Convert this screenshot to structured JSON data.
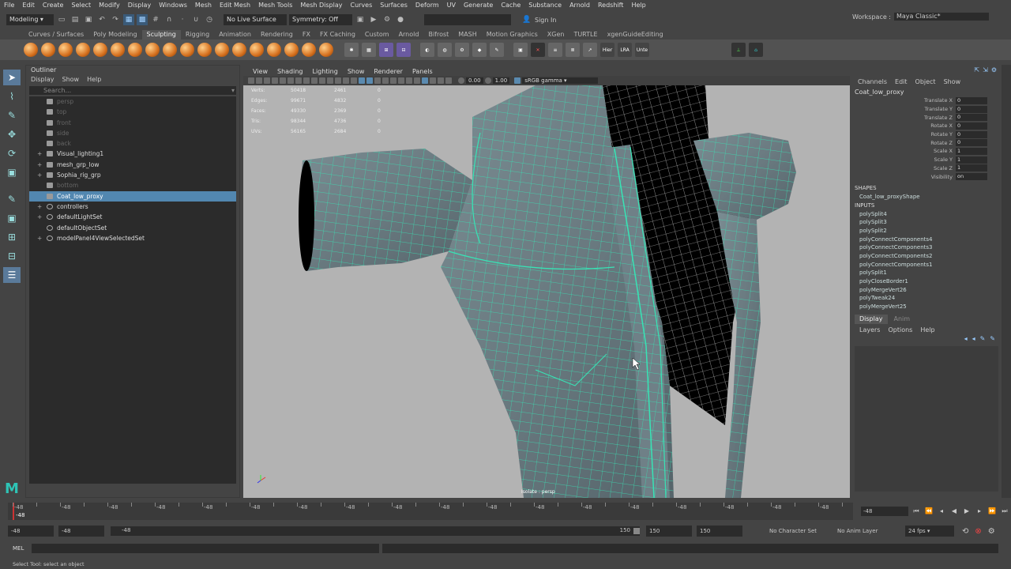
{
  "menubar": {
    "items": [
      "File",
      "Edit",
      "Create",
      "Select",
      "Modify",
      "Display",
      "Windows",
      "Mesh",
      "Edit Mesh",
      "Mesh Tools",
      "Mesh Display",
      "Curves",
      "Surfaces",
      "Deform",
      "UV",
      "Generate",
      "Cache",
      "Substance",
      "Arnold",
      "Redshift",
      "Help"
    ],
    "workspace_label": "Workspace :",
    "workspace_value": "Maya Classic*"
  },
  "statusline": {
    "mode": "Modeling",
    "live": "No Live Surface",
    "symmetry": "Symmetry: Off",
    "signin": "Sign In"
  },
  "shelf": {
    "tabs": [
      "Curves / Surfaces",
      "Poly Modeling",
      "Sculpting",
      "Rigging",
      "Animation",
      "Rendering",
      "FX",
      "FX Caching",
      "Custom",
      "Arnold",
      "Bifrost",
      "MASH",
      "Motion Graphics",
      "XGen",
      "TURTLE",
      "xgenGuideEditing"
    ],
    "active_tab": "Sculpting",
    "labels": [
      "Hier",
      "LRA",
      "Unte"
    ]
  },
  "outliner": {
    "title": "Outliner",
    "menu": [
      "Display",
      "Show",
      "Help"
    ],
    "search_placeholder": "Search...",
    "rows": [
      {
        "label": "persp",
        "dim": true,
        "expand": ""
      },
      {
        "label": "top",
        "dim": true,
        "expand": ""
      },
      {
        "label": "front",
        "dim": true,
        "expand": ""
      },
      {
        "label": "side",
        "dim": true,
        "expand": ""
      },
      {
        "label": "back",
        "dim": true,
        "expand": ""
      },
      {
        "label": "Visual_lighting1",
        "dim": false,
        "expand": "+"
      },
      {
        "label": "mesh_grp_low",
        "dim": false,
        "expand": "+"
      },
      {
        "label": "Sophia_rig_grp",
        "dim": false,
        "expand": "+"
      },
      {
        "label": "bottom",
        "dim": true,
        "expand": ""
      },
      {
        "label": "Coat_low_proxy",
        "dim": false,
        "expand": "",
        "selected": true
      },
      {
        "label": "controllers",
        "dim": false,
        "expand": "+"
      },
      {
        "label": "defaultLightSet",
        "dim": false,
        "expand": "+"
      },
      {
        "label": "defaultObjectSet",
        "dim": false,
        "expand": ""
      },
      {
        "label": "modelPanel4ViewSelectedSet",
        "dim": false,
        "expand": "+"
      }
    ]
  },
  "viewport": {
    "menu": [
      "View",
      "Shading",
      "Lighting",
      "Show",
      "Renderer",
      "Panels"
    ],
    "near": "0.00",
    "far": "1.00",
    "colorspace": "sRGB gamma",
    "hud": [
      {
        "label": "Verts:",
        "a": "50418",
        "b": "2461",
        "c": "0"
      },
      {
        "label": "Edges:",
        "a": "99671",
        "b": "4832",
        "c": "0"
      },
      {
        "label": "Faces:",
        "a": "49330",
        "b": "2369",
        "c": "0"
      },
      {
        "label": "Tris:",
        "a": "98344",
        "b": "4736",
        "c": "0"
      },
      {
        "label": "UVs:",
        "a": "56165",
        "b": "2684",
        "c": "0"
      }
    ],
    "camera_label": "Isolate : persp"
  },
  "channelbox": {
    "menu": [
      "Channels",
      "Edit",
      "Object",
      "Show"
    ],
    "object": "Coat_low_proxy",
    "attrs": [
      {
        "n": "Translate X",
        "v": "0"
      },
      {
        "n": "Translate Y",
        "v": "0"
      },
      {
        "n": "Translate Z",
        "v": "0"
      },
      {
        "n": "Rotate X",
        "v": "0"
      },
      {
        "n": "Rotate Y",
        "v": "0"
      },
      {
        "n": "Rotate Z",
        "v": "0"
      },
      {
        "n": "Scale X",
        "v": "1"
      },
      {
        "n": "Scale Y",
        "v": "1"
      },
      {
        "n": "Scale Z",
        "v": "1"
      },
      {
        "n": "Visibility",
        "v": "on"
      }
    ],
    "shapes_label": "SHAPES",
    "shape": "Coat_low_proxyShape",
    "inputs_label": "INPUTS",
    "inputs": [
      "polySplit4",
      "polySplit3",
      "polySplit2",
      "polyConnectComponents4",
      "polyConnectComponents3",
      "polyConnectComponents2",
      "polyConnectComponents1",
      "polySplit1",
      "polyCloseBorder1",
      "polyMergeVert26",
      "polyTweak24",
      "polyMergeVert25"
    ],
    "layer_tabs": [
      "Display",
      "Anim"
    ],
    "layer_menu": [
      "Layers",
      "Options",
      "Help"
    ]
  },
  "timeline": {
    "ticks": [
      "-48",
      "-48",
      "-48",
      "-48",
      "-48",
      "-48",
      "-48",
      "-48",
      "-48",
      "-48",
      "-48",
      "-48",
      "-48",
      "-48",
      "-48",
      "-48",
      "-48",
      "-48",
      "-48",
      "-48",
      "-48",
      "-48",
      "-48",
      "-48",
      "-48",
      "-48",
      "-48",
      "-48",
      "-48",
      "-48",
      "-48",
      "-48",
      "-48",
      "-48",
      "-48",
      "-48"
    ],
    "current": "-48",
    "current_field": "-48"
  },
  "range": {
    "start": "-48",
    "anim_start": "-48",
    "slider_val": "-48",
    "slider_end": "150",
    "end": "150",
    "anim_end": "150",
    "char_set": "No Character Set",
    "anim_layer": "No Anim Layer",
    "fps": "24 fps"
  },
  "mel": {
    "label": "MEL"
  },
  "help": {
    "text": "Select Tool: select an object"
  },
  "colors": {
    "accent": "#5287b0",
    "wire": "#35e0b0"
  }
}
